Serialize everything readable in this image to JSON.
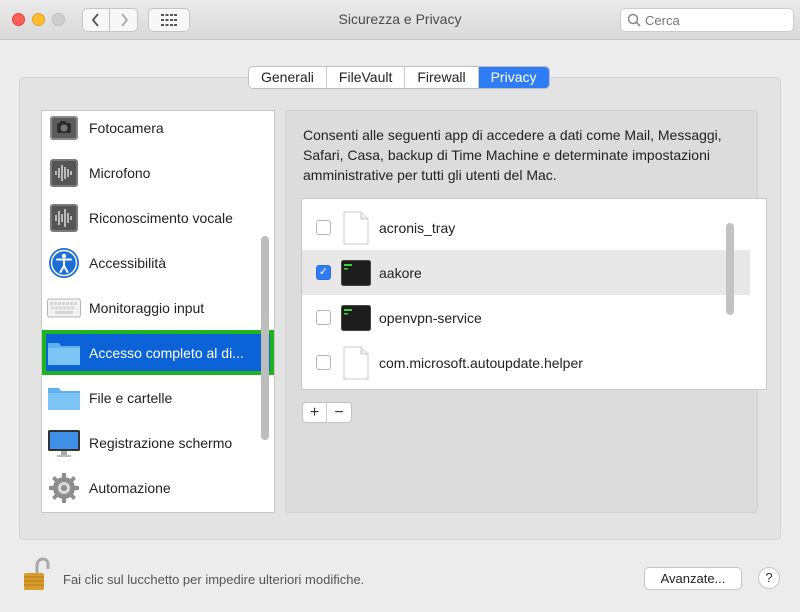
{
  "window": {
    "title": "Sicurezza e Privacy"
  },
  "search": {
    "placeholder": "Cerca"
  },
  "tabs": [
    {
      "label": "Generali",
      "active": false
    },
    {
      "label": "FileVault",
      "active": false
    },
    {
      "label": "Firewall",
      "active": false
    },
    {
      "label": "Privacy",
      "active": true
    }
  ],
  "sidebar": {
    "items": [
      {
        "label": "Fotocamera",
        "icon": "camera-icon"
      },
      {
        "label": "Microfono",
        "icon": "microphone-icon"
      },
      {
        "label": "Riconoscimento vocale",
        "icon": "speech-recognition-icon"
      },
      {
        "label": "Accessibilità",
        "icon": "accessibility-icon"
      },
      {
        "label": "Monitoraggio input",
        "icon": "keyboard-icon"
      },
      {
        "label": "Accesso completo al di...",
        "icon": "folder-icon",
        "selected": true
      },
      {
        "label": "File e cartelle",
        "icon": "folder-icon"
      },
      {
        "label": "Registrazione schermo",
        "icon": "display-icon"
      },
      {
        "label": "Automazione",
        "icon": "gear-icon"
      }
    ]
  },
  "main": {
    "description": "Consenti alle seguenti app di accedere a dati come Mail, Messaggi, Safari, Casa, backup di Time Machine e determinate impostazioni amministrative per tutti gli utenti del Mac.",
    "apps": [
      {
        "name": "acronis_tray",
        "checked": false,
        "icon": "document-icon"
      },
      {
        "name": "aakore",
        "checked": true,
        "icon": "terminal-icon"
      },
      {
        "name": "openvpn-service",
        "checked": false,
        "icon": "terminal-icon"
      },
      {
        "name": "com.microsoft.autoupdate.helper",
        "checked": false,
        "icon": "document-icon"
      }
    ],
    "add_label": "+",
    "remove_label": "−"
  },
  "footer": {
    "lock_text": "Fai clic sul lucchetto per impedire ulteriori modifiche.",
    "advanced_label": "Avanzate...",
    "help_label": "?"
  },
  "colors": {
    "accent": "#2f7df6",
    "selection": "#0c63d7",
    "highlight_outline": "#1fb41f"
  }
}
